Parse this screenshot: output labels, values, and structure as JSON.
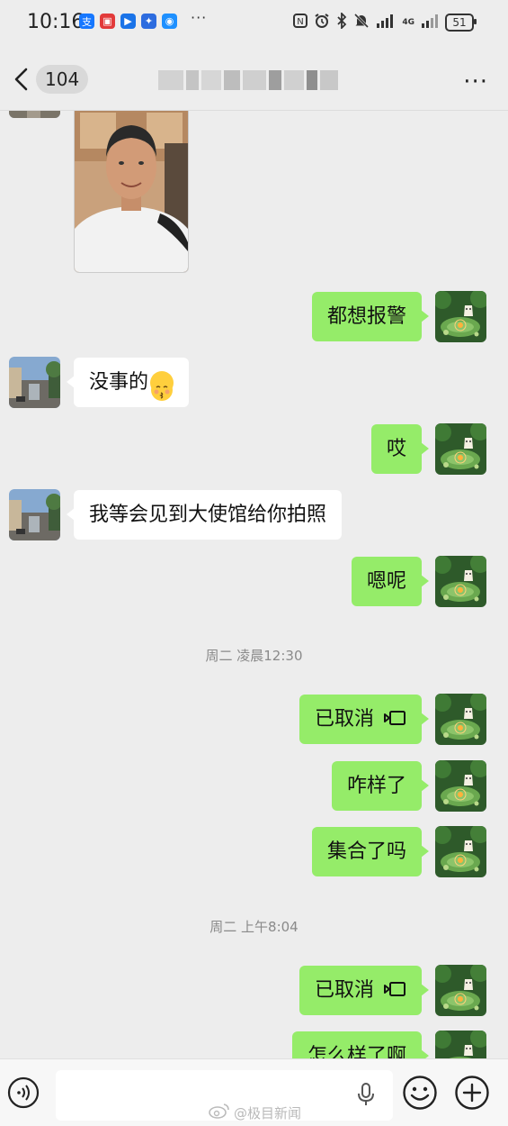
{
  "status_bar": {
    "time": "10:16",
    "app_icons": [
      {
        "name": "alipay-icon",
        "glyph": "支",
        "color": "#1677ff"
      },
      {
        "name": "red-app-icon",
        "glyph": "▣",
        "color": "#e23a3a"
      },
      {
        "name": "blue-app-icon",
        "glyph": "▶",
        "color": "#1a73e8"
      },
      {
        "name": "bulb-app-icon",
        "glyph": "✦",
        "color": "#2d6cdf"
      },
      {
        "name": "chat-app-icon",
        "glyph": "◉",
        "color": "#1e90ff"
      }
    ],
    "more_dots": "···",
    "network": "4G",
    "battery": "51"
  },
  "header": {
    "unread_count": "104",
    "more_label": "···"
  },
  "messages": [
    {
      "type": "image",
      "sender": "them"
    },
    {
      "type": "text",
      "sender": "me",
      "text": "都想报警"
    },
    {
      "type": "text",
      "sender": "them",
      "text": "没事的"
    },
    {
      "type": "text",
      "sender": "me",
      "text": "哎"
    },
    {
      "type": "text",
      "sender": "them",
      "text": "我等会见到大使馆给你拍照"
    },
    {
      "type": "text",
      "sender": "me",
      "text": "嗯呢"
    },
    {
      "type": "time",
      "text": "周二 凌晨12:30"
    },
    {
      "type": "call",
      "sender": "me",
      "text": "已取消"
    },
    {
      "type": "text",
      "sender": "me",
      "text": "咋样了"
    },
    {
      "type": "text",
      "sender": "me",
      "text": "集合了吗"
    },
    {
      "type": "time",
      "text": "周二 上午8:04"
    },
    {
      "type": "call",
      "sender": "me",
      "text": "已取消"
    },
    {
      "type": "text",
      "sender": "me",
      "text": "怎么样了啊"
    }
  ],
  "input_bar": {
    "placeholder": ""
  },
  "watermark": "@极目新闻",
  "colors": {
    "my_bubble": "#95ec69",
    "their_bubble": "#ffffff",
    "background": "#ededed"
  }
}
